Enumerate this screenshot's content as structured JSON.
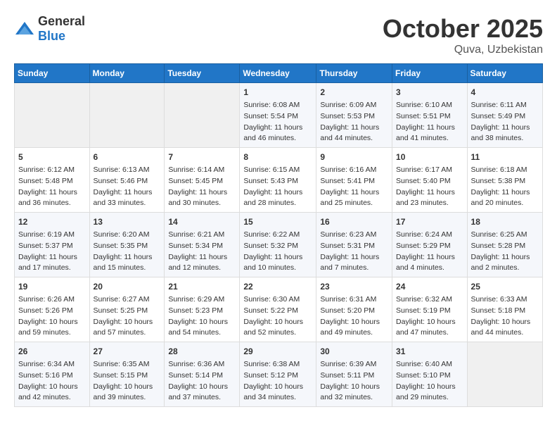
{
  "header": {
    "logo_general": "General",
    "logo_blue": "Blue",
    "month": "October 2025",
    "location": "Quva, Uzbekistan"
  },
  "weekdays": [
    "Sunday",
    "Monday",
    "Tuesday",
    "Wednesday",
    "Thursday",
    "Friday",
    "Saturday"
  ],
  "weeks": [
    [
      {
        "day": "",
        "empty": true
      },
      {
        "day": "",
        "empty": true
      },
      {
        "day": "",
        "empty": true
      },
      {
        "day": "1",
        "sunrise": "Sunrise: 6:08 AM",
        "sunset": "Sunset: 5:54 PM",
        "daylight": "Daylight: 11 hours and 46 minutes."
      },
      {
        "day": "2",
        "sunrise": "Sunrise: 6:09 AM",
        "sunset": "Sunset: 5:53 PM",
        "daylight": "Daylight: 11 hours and 44 minutes."
      },
      {
        "day": "3",
        "sunrise": "Sunrise: 6:10 AM",
        "sunset": "Sunset: 5:51 PM",
        "daylight": "Daylight: 11 hours and 41 minutes."
      },
      {
        "day": "4",
        "sunrise": "Sunrise: 6:11 AM",
        "sunset": "Sunset: 5:49 PM",
        "daylight": "Daylight: 11 hours and 38 minutes."
      }
    ],
    [
      {
        "day": "5",
        "sunrise": "Sunrise: 6:12 AM",
        "sunset": "Sunset: 5:48 PM",
        "daylight": "Daylight: 11 hours and 36 minutes."
      },
      {
        "day": "6",
        "sunrise": "Sunrise: 6:13 AM",
        "sunset": "Sunset: 5:46 PM",
        "daylight": "Daylight: 11 hours and 33 minutes."
      },
      {
        "day": "7",
        "sunrise": "Sunrise: 6:14 AM",
        "sunset": "Sunset: 5:45 PM",
        "daylight": "Daylight: 11 hours and 30 minutes."
      },
      {
        "day": "8",
        "sunrise": "Sunrise: 6:15 AM",
        "sunset": "Sunset: 5:43 PM",
        "daylight": "Daylight: 11 hours and 28 minutes."
      },
      {
        "day": "9",
        "sunrise": "Sunrise: 6:16 AM",
        "sunset": "Sunset: 5:41 PM",
        "daylight": "Daylight: 11 hours and 25 minutes."
      },
      {
        "day": "10",
        "sunrise": "Sunrise: 6:17 AM",
        "sunset": "Sunset: 5:40 PM",
        "daylight": "Daylight: 11 hours and 23 minutes."
      },
      {
        "day": "11",
        "sunrise": "Sunrise: 6:18 AM",
        "sunset": "Sunset: 5:38 PM",
        "daylight": "Daylight: 11 hours and 20 minutes."
      }
    ],
    [
      {
        "day": "12",
        "sunrise": "Sunrise: 6:19 AM",
        "sunset": "Sunset: 5:37 PM",
        "daylight": "Daylight: 11 hours and 17 minutes."
      },
      {
        "day": "13",
        "sunrise": "Sunrise: 6:20 AM",
        "sunset": "Sunset: 5:35 PM",
        "daylight": "Daylight: 11 hours and 15 minutes."
      },
      {
        "day": "14",
        "sunrise": "Sunrise: 6:21 AM",
        "sunset": "Sunset: 5:34 PM",
        "daylight": "Daylight: 11 hours and 12 minutes."
      },
      {
        "day": "15",
        "sunrise": "Sunrise: 6:22 AM",
        "sunset": "Sunset: 5:32 PM",
        "daylight": "Daylight: 11 hours and 10 minutes."
      },
      {
        "day": "16",
        "sunrise": "Sunrise: 6:23 AM",
        "sunset": "Sunset: 5:31 PM",
        "daylight": "Daylight: 11 hours and 7 minutes."
      },
      {
        "day": "17",
        "sunrise": "Sunrise: 6:24 AM",
        "sunset": "Sunset: 5:29 PM",
        "daylight": "Daylight: 11 hours and 4 minutes."
      },
      {
        "day": "18",
        "sunrise": "Sunrise: 6:25 AM",
        "sunset": "Sunset: 5:28 PM",
        "daylight": "Daylight: 11 hours and 2 minutes."
      }
    ],
    [
      {
        "day": "19",
        "sunrise": "Sunrise: 6:26 AM",
        "sunset": "Sunset: 5:26 PM",
        "daylight": "Daylight: 10 hours and 59 minutes."
      },
      {
        "day": "20",
        "sunrise": "Sunrise: 6:27 AM",
        "sunset": "Sunset: 5:25 PM",
        "daylight": "Daylight: 10 hours and 57 minutes."
      },
      {
        "day": "21",
        "sunrise": "Sunrise: 6:29 AM",
        "sunset": "Sunset: 5:23 PM",
        "daylight": "Daylight: 10 hours and 54 minutes."
      },
      {
        "day": "22",
        "sunrise": "Sunrise: 6:30 AM",
        "sunset": "Sunset: 5:22 PM",
        "daylight": "Daylight: 10 hours and 52 minutes."
      },
      {
        "day": "23",
        "sunrise": "Sunrise: 6:31 AM",
        "sunset": "Sunset: 5:20 PM",
        "daylight": "Daylight: 10 hours and 49 minutes."
      },
      {
        "day": "24",
        "sunrise": "Sunrise: 6:32 AM",
        "sunset": "Sunset: 5:19 PM",
        "daylight": "Daylight: 10 hours and 47 minutes."
      },
      {
        "day": "25",
        "sunrise": "Sunrise: 6:33 AM",
        "sunset": "Sunset: 5:18 PM",
        "daylight": "Daylight: 10 hours and 44 minutes."
      }
    ],
    [
      {
        "day": "26",
        "sunrise": "Sunrise: 6:34 AM",
        "sunset": "Sunset: 5:16 PM",
        "daylight": "Daylight: 10 hours and 42 minutes."
      },
      {
        "day": "27",
        "sunrise": "Sunrise: 6:35 AM",
        "sunset": "Sunset: 5:15 PM",
        "daylight": "Daylight: 10 hours and 39 minutes."
      },
      {
        "day": "28",
        "sunrise": "Sunrise: 6:36 AM",
        "sunset": "Sunset: 5:14 PM",
        "daylight": "Daylight: 10 hours and 37 minutes."
      },
      {
        "day": "29",
        "sunrise": "Sunrise: 6:38 AM",
        "sunset": "Sunset: 5:12 PM",
        "daylight": "Daylight: 10 hours and 34 minutes."
      },
      {
        "day": "30",
        "sunrise": "Sunrise: 6:39 AM",
        "sunset": "Sunset: 5:11 PM",
        "daylight": "Daylight: 10 hours and 32 minutes."
      },
      {
        "day": "31",
        "sunrise": "Sunrise: 6:40 AM",
        "sunset": "Sunset: 5:10 PM",
        "daylight": "Daylight: 10 hours and 29 minutes."
      },
      {
        "day": "",
        "empty": true
      }
    ]
  ]
}
